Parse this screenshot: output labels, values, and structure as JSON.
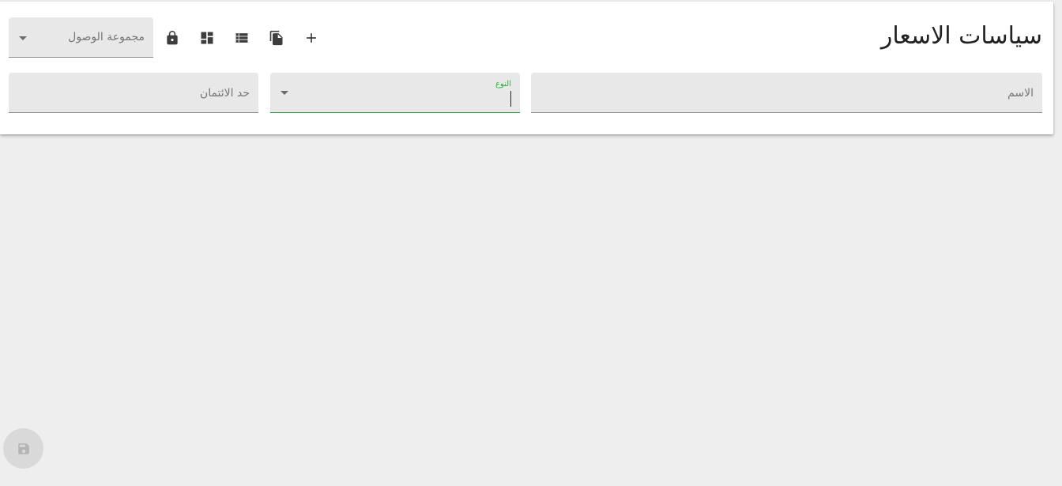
{
  "header": {
    "title": "سياسات الاسعار",
    "access_group": {
      "placeholder": "مجموعة الوصول"
    }
  },
  "toolbar": {
    "icons": [
      "lock-icon",
      "dashboard-icon",
      "list-icon",
      "copy-icon",
      "add-icon"
    ]
  },
  "form": {
    "name": {
      "label": "الاسم"
    },
    "type": {
      "label": "النوع"
    },
    "credit_limit": {
      "label": "حد الائتمان"
    }
  },
  "fab": {
    "icon": "save-icon"
  },
  "colors": {
    "accent": "#2eae3e",
    "background": "#eeeeee",
    "card": "#ffffff"
  }
}
